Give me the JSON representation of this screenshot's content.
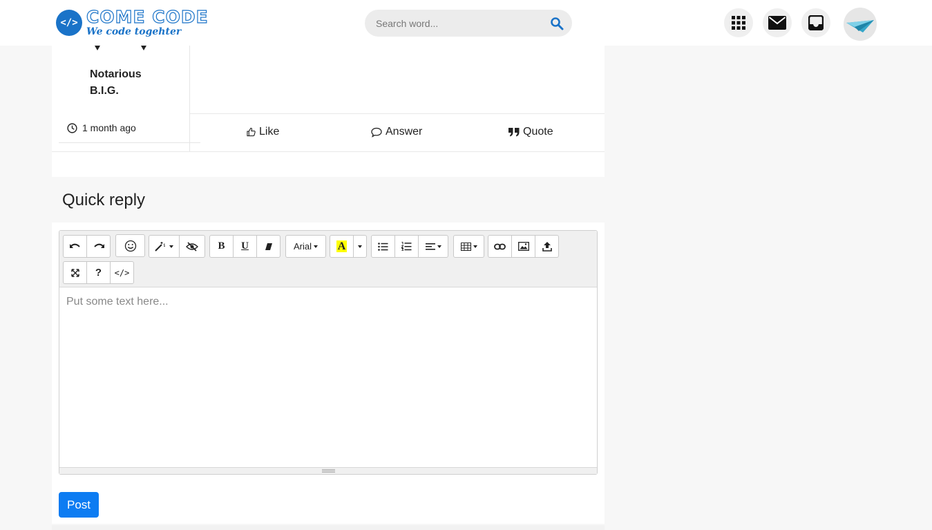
{
  "header": {
    "logo_badge": "</>",
    "logo_name": "COME CODE",
    "logo_tagline": "We code togehter",
    "search_placeholder": "Search word...",
    "icons": [
      "grid-icon",
      "mail-icon",
      "inbox-icon",
      "avatar"
    ]
  },
  "post": {
    "username": "Notarious B.I.G.",
    "time": "1 month ago",
    "actions": {
      "like": "Like",
      "answer": "Answer",
      "quote": "Quote"
    }
  },
  "quick_reply": {
    "title": "Quick reply",
    "editor": {
      "font_name": "Arial",
      "placeholder": "Put some text here...",
      "toolbar_icons": [
        "undo-icon",
        "redo-icon",
        "emoji-icon",
        "magic-wand-icon",
        "hide-icon",
        "bold-icon",
        "underline-icon",
        "eraser-icon",
        "font-dropdown",
        "text-color-icon",
        "color-dropdown",
        "bullet-list-icon",
        "numbered-list-icon",
        "align-icon",
        "table-icon",
        "link-icon",
        "image-icon",
        "upload-icon",
        "fullscreen-icon",
        "help-icon",
        "code-view-icon"
      ],
      "bold_glyph": "B",
      "underline_glyph": "U",
      "text_color_glyph": "A",
      "help_glyph": "?",
      "code_glyph": "</>"
    },
    "submit_label": "Post"
  },
  "colors": {
    "brand": "#1a73c8",
    "primary_button": "#0d7cf2",
    "page_background": "#f7f7f7"
  }
}
